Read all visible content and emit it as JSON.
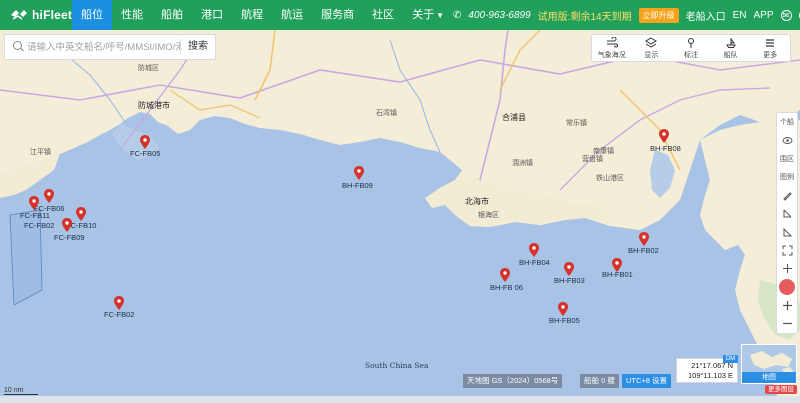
{
  "brand": {
    "name": "hiFleet"
  },
  "nav": {
    "items": [
      {
        "label": "船位",
        "active": true
      },
      {
        "label": "性能"
      },
      {
        "label": "船舶"
      },
      {
        "label": "港口"
      },
      {
        "label": "航程"
      },
      {
        "label": "航运"
      },
      {
        "label": "服务商"
      },
      {
        "label": "社区"
      },
      {
        "label": "关于"
      }
    ]
  },
  "topright": {
    "phone": "400-963-6899",
    "trial": "试用版:剩余14天到期",
    "upgrade": "立即升级",
    "old_entry": "老船入口",
    "lang": "EN",
    "app": "APP"
  },
  "search": {
    "placeholder": "请输入中英文船名/呼号/MMSI/IMO/港口",
    "button": "搜索"
  },
  "tools": [
    {
      "label": "气象海况",
      "icon": "wind-icon"
    },
    {
      "label": "显示",
      "icon": "layers-icon"
    },
    {
      "label": "标注",
      "icon": "pin-icon"
    },
    {
      "label": "船队",
      "icon": "ship-icon"
    },
    {
      "label": "更多",
      "icon": "menu-icon"
    }
  ],
  "rail": [
    {
      "label": "个船",
      "icon": "ship-mini-icon"
    },
    {
      "label": "",
      "icon": "eye-icon"
    },
    {
      "label": "围区",
      "icon": "area-icon"
    },
    {
      "label": "图例",
      "icon": "legend-icon"
    },
    {
      "label": "",
      "icon": "pencil-icon"
    },
    {
      "label": "",
      "icon": "ruler-icon"
    },
    {
      "label": "",
      "icon": "triangle-icon"
    },
    {
      "label": "",
      "icon": "fullscreen-icon"
    },
    {
      "label": "",
      "icon": "plus-icon"
    },
    {
      "label": "",
      "icon": "sos-icon"
    },
    {
      "label": "",
      "icon": "zoom-in-icon"
    },
    {
      "label": "",
      "icon": "zoom-out-icon"
    }
  ],
  "markers": [
    {
      "label": "FC-FB05"
    },
    {
      "label": "BH-FB09"
    },
    {
      "label": "FC-FB06"
    },
    {
      "label": "FC-FB11"
    },
    {
      "label": "FC-FB10"
    },
    {
      "label": "FC-FB02"
    },
    {
      "label": "FC-FB09"
    },
    {
      "label": "FC-FB02"
    },
    {
      "label": "BH-FB08"
    },
    {
      "label": "BH-FB02"
    },
    {
      "label": "BH-FB04"
    },
    {
      "label": "BH-FB03"
    },
    {
      "label": "BH-FB01"
    },
    {
      "label": "BH-FB 06"
    },
    {
      "label": "BH-FB05"
    }
  ],
  "places": [
    {
      "name": "防城区"
    },
    {
      "name": "防城港市"
    },
    {
      "name": "江平镇"
    },
    {
      "name": "北海市"
    },
    {
      "name": "银海区"
    },
    {
      "name": "合浦县"
    },
    {
      "name": "铁山港区"
    },
    {
      "name": "涠洲镇"
    },
    {
      "name": "石湾镇"
    },
    {
      "name": "常乐镇"
    },
    {
      "name": "营盘镇"
    },
    {
      "name": "南康镇"
    }
  ],
  "sea": {
    "name": "South China Sea"
  },
  "footer": {
    "tianditu": "天地图 GS（2024）0568号",
    "ships": "船舶 0 艘",
    "utc": "UTC+8 设置",
    "coord_lat": "21°17.067 N",
    "coord_lon": "109°11.103 E",
    "dm": "DM",
    "map_type": "地图",
    "more": "更多图层",
    "scale": "10 nm"
  }
}
